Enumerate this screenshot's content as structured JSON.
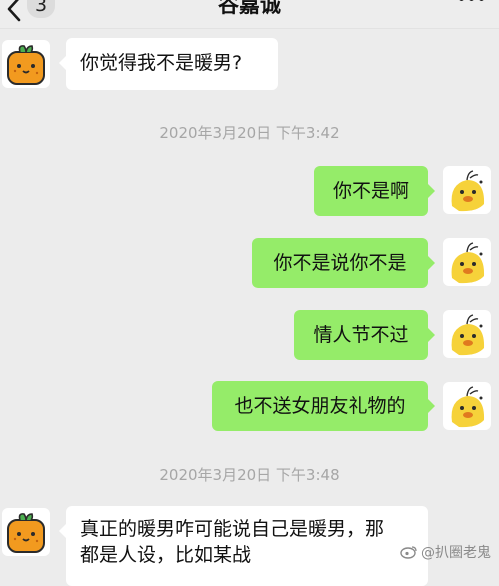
{
  "header": {
    "unread_count": "3",
    "title": "谷嘉诚"
  },
  "messages": {
    "m1": "你觉得我不是暖男?",
    "ts1": "2020年3月20日 下午3:42",
    "m2": "你不是啊",
    "m3": "你不是说你不是",
    "m4": "情人节不过",
    "m5": "也不送女朋友礼物的",
    "ts2": "2020年3月20日 下午3:48",
    "m6_line1": "真正的暖男咋可能说自己是暖男，那",
    "m6_line2": "都是人设，比如某战"
  },
  "watermark": "@扒圈老鬼",
  "icons": {
    "back": "chevron-left-icon",
    "more": "more-dots-icon",
    "contact_avatar": "orange-fruit-avatar",
    "self_avatar": "yellow-chick-avatar"
  },
  "colors": {
    "background": "#ececec",
    "self_bubble": "#95ec69",
    "other_bubble": "#ffffff",
    "timestamp": "#a6a6a6"
  }
}
